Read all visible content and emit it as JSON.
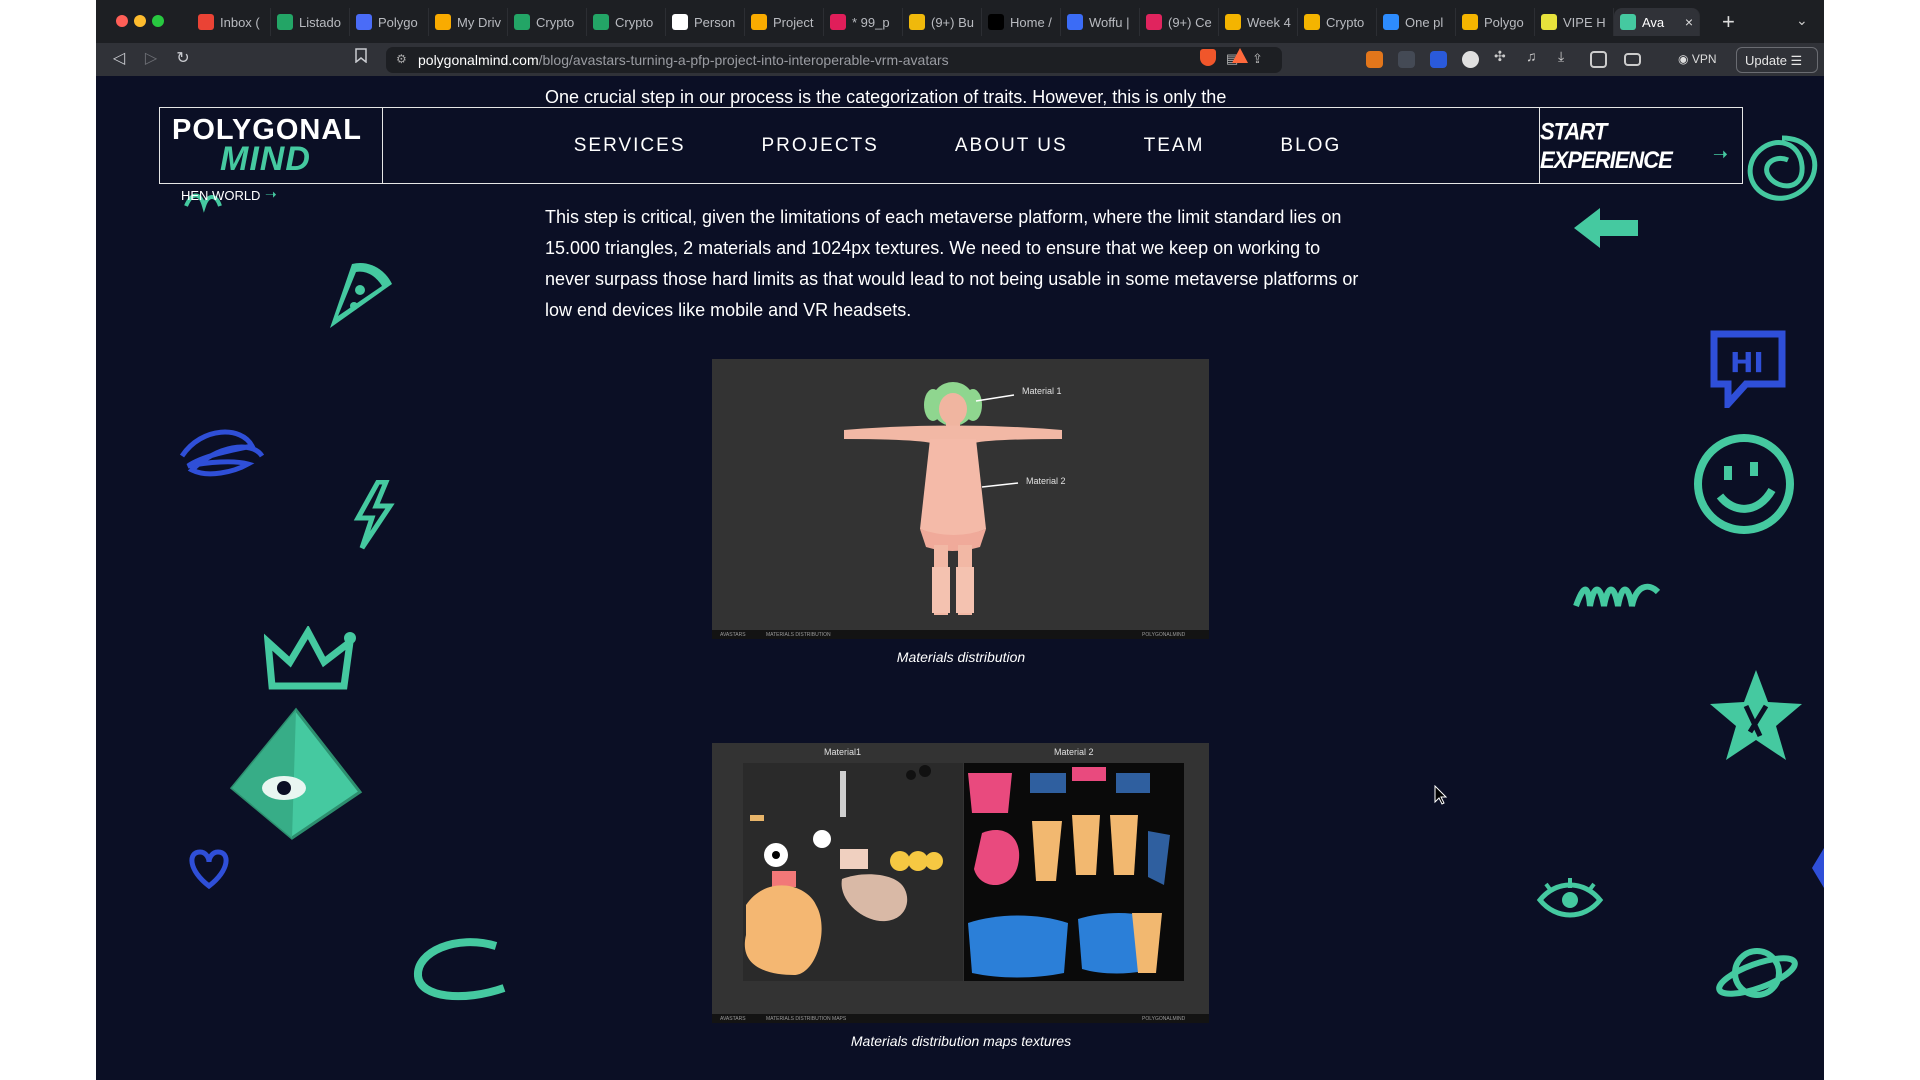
{
  "browser": {
    "tabs": [
      {
        "title": "Inbox (",
        "color": "#ea4335"
      },
      {
        "title": "Listado",
        "color": "#23a566"
      },
      {
        "title": "Polygo",
        "color": "#4a6cf7"
      },
      {
        "title": "My Driv",
        "color": "#f9ab00"
      },
      {
        "title": "Crypto",
        "color": "#23a566"
      },
      {
        "title": "Crypto",
        "color": "#23a566"
      },
      {
        "title": "Person",
        "color": "#ffffff"
      },
      {
        "title": "Project",
        "color": "#f9ab00"
      },
      {
        "title": "* 99_p",
        "color": "#e01e5a"
      },
      {
        "title": "(9+) Bu",
        "color": "#f0b90b"
      },
      {
        "title": "Home /",
        "color": "#000000"
      },
      {
        "title": "Woffu |",
        "color": "#3b6cf6"
      },
      {
        "title": "(9+) Ce",
        "color": "#e0245e"
      },
      {
        "title": "Week 4",
        "color": "#f4b400"
      },
      {
        "title": "Crypto",
        "color": "#f4b400"
      },
      {
        "title": "One pl",
        "color": "#2d8cff"
      },
      {
        "title": "Polygo",
        "color": "#f4b400"
      },
      {
        "title": "VIPE H",
        "color": "#e7e23c"
      },
      {
        "title": "Ava",
        "color": "#45c9a0"
      }
    ],
    "url_host": "polygonalmind.com",
    "url_path": "/blog/avastars-turning-a-pfp-project-into-interoperable-vrm-avatars",
    "vpn_label": "VPN",
    "update_label": "Update",
    "new_tab_glyph": "+",
    "tab_menu_glyph": "⌄",
    "close_glyph": "×"
  },
  "site": {
    "logo_top": "POLYGONAL",
    "logo_bottom": "MIND",
    "nav": [
      "SERVICES",
      "PROJECTS",
      "ABOUT US",
      "TEAM",
      "BLOG"
    ],
    "cta": "START EXPERIENCE",
    "hen_world": "HEN WORLD"
  },
  "article": {
    "intro_line_pre": "One crucial step in our process is the ",
    "intro_line_bold": "categorization of traits",
    "intro_line_post": ". However, this is only the",
    "p_pre": "This step is critical, given the ",
    "p_bold": "limitations of each metaverse platform",
    "p_post": ", where the limit standard lies on 15.000 triangles, 2 materials and 1024px textures. We need to ensure that we keep on working to never surpass those hard limits as that would lead to not being usable in some metaverse platforms or low end devices like mobile and VR headsets.",
    "figure1": {
      "label_material1": "Material 1",
      "label_material2": "Material 2",
      "footer_left": "AVASTARS",
      "footer_mid": "MATERIALS DISTRIBUTION",
      "footer_right": "POLYGONALMIND",
      "caption": "Materials distribution"
    },
    "figure2": {
      "label_material1": "Material1",
      "label_material2": "Material 2",
      "footer_left": "AVASTARS",
      "footer_mid": "MATERIALS DISTRIBUTION MAPS",
      "footer_right": "POLYGONALMIND",
      "caption": "Materials distribution maps textures"
    }
  },
  "colors": {
    "page_bg": "#0b0f25",
    "accent": "#45c9a0",
    "doodle_blue": "#2f4fd8"
  }
}
